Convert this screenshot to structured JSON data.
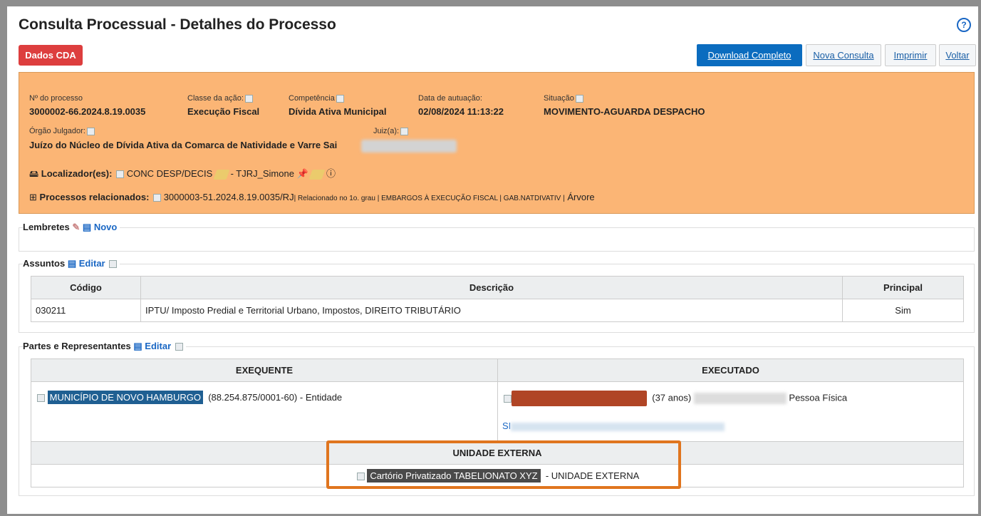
{
  "title": "Consulta Processual - Detalhes do Processo",
  "help_icon": "question-circle-icon",
  "buttons": {
    "cda": "Dados CDA",
    "download": "Download Completo",
    "nova": "Nova Consulta",
    "imprimir": "Imprimir",
    "voltar": "Voltar"
  },
  "process": {
    "numero_label": "Nº do processo",
    "numero": "3000002-66.2024.8.19.0035",
    "classe_label": "Classe da ação:",
    "classe": "Execução Fiscal",
    "competencia_label": "Competência",
    "competencia": "Dívida Ativa Municipal",
    "data_label": "Data de autuação:",
    "data": "02/08/2024 11:13:22",
    "situacao_label": "Situação",
    "situacao": "MOVIMENTO-AGUARDA DESPACHO",
    "orgao_label": "Órgão Julgador:",
    "orgao": "Juízo do Núcleo de Dívida Ativa da Comarca de Natividade e Varre Sai",
    "juiz_label": "Juiz(a):",
    "localizador_label": "Localizador(es):",
    "localizador_1": "CONC DESP/DECIS",
    "localizador_2": "- TJRJ_Simone",
    "relacionados_label": "Processos relacionados:",
    "relacionados_num": "3000003-51.2024.8.19.0035/RJ",
    "relacionados_detail": "| Relacionado no 1o. grau | EMBARGOS À EXECUÇÃO FISCAL | GAB.NATDIVATIV |",
    "arvore": "Árvore"
  },
  "lembretes": {
    "title": "Lembretes",
    "novo": "Novo"
  },
  "assuntos": {
    "title": "Assuntos",
    "editar": "Editar",
    "headers": [
      "Código",
      "Descrição",
      "Principal"
    ],
    "rows": [
      [
        "030211",
        "IPTU/ Imposto Predial e Territorial Urbano, Impostos, DIREITO TRIBUTÁRIO",
        "Sim"
      ]
    ]
  },
  "partes": {
    "title": "Partes e Representantes",
    "editar": "Editar",
    "exequente_header": "EXEQUENTE",
    "executado_header": "EXECUTADO",
    "exequente_nome": "MUNICÍPIO DE NOVO HAMBURGO",
    "exequente_doc": "(88.254.875/0001-60)",
    "exequente_tipo": "- Entidade",
    "executado_idade": "(37 anos)",
    "executado_tipo": "Pessoa Física",
    "executado_link_prefix": "SI",
    "unidade_header": "UNIDADE EXTERNA",
    "unidade_nome": "Cartório Privatizado TABELIONATO XYZ",
    "unidade_tipo": "- UNIDADE EXTERNA"
  }
}
